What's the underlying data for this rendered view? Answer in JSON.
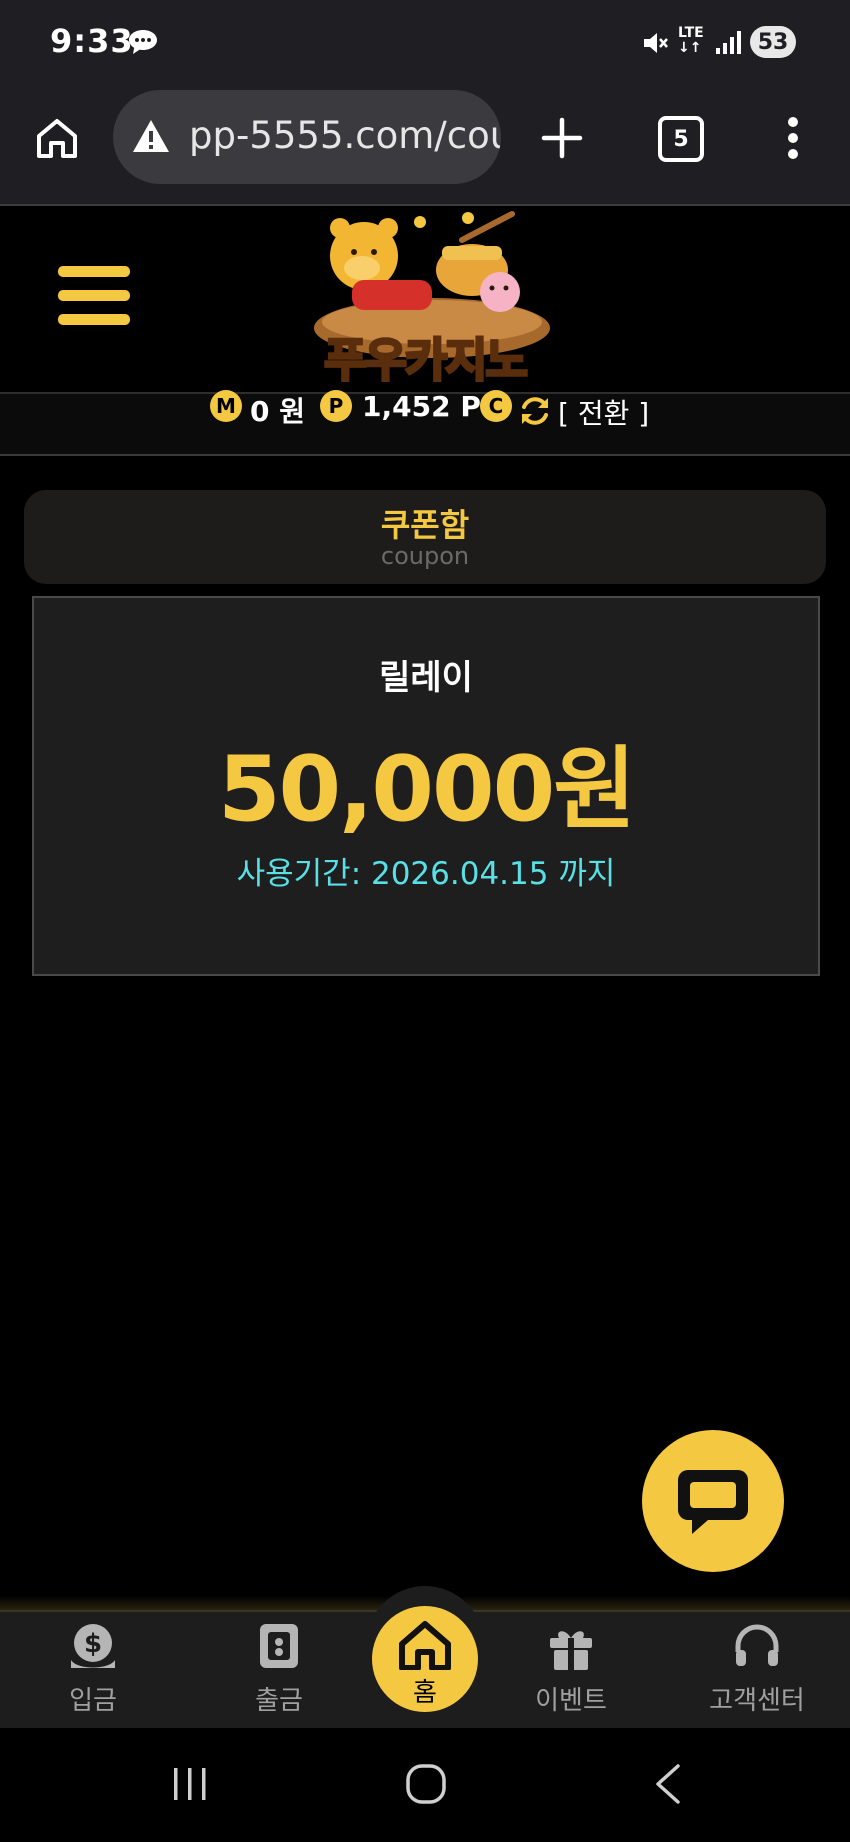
{
  "status_bar": {
    "time": "9:33",
    "network": "LTE",
    "battery": "53",
    "icons": [
      "chat-bubble-icon",
      "mute-icon",
      "signal-icon"
    ]
  },
  "browser": {
    "url": "pp-5555.com/cou",
    "tab_count": "5",
    "icons": [
      "home-icon",
      "warning-icon",
      "plus-icon",
      "more-vertical-icon"
    ]
  },
  "site": {
    "logo_text": "푸우카지노",
    "menu_icon": "hamburger-icon"
  },
  "balance": {
    "money_badge": "M",
    "money": "0 원",
    "point_badge": "P",
    "points": "1,452 P",
    "comp_badge": "C",
    "convert_label": "[ 전환 ]"
  },
  "coupon_page": {
    "title": "쿠폰함",
    "subtitle": "coupon"
  },
  "coupon": {
    "name": "릴레이",
    "amount": "50,000원",
    "expiry": "사용기간: 2026.04.15 까지"
  },
  "bottom_nav": {
    "items": [
      {
        "label": "입금",
        "icon": "dollar-coin-icon"
      },
      {
        "label": "출금",
        "icon": "safe-icon"
      },
      {
        "label": "홈",
        "icon": "house-icon"
      },
      {
        "label": "이벤트",
        "icon": "gift-icon"
      },
      {
        "label": "고객센터",
        "icon": "headset-icon"
      }
    ]
  },
  "colors": {
    "accent": "#f5c842",
    "expiry_text": "#58e0e6",
    "background": "#000000"
  }
}
